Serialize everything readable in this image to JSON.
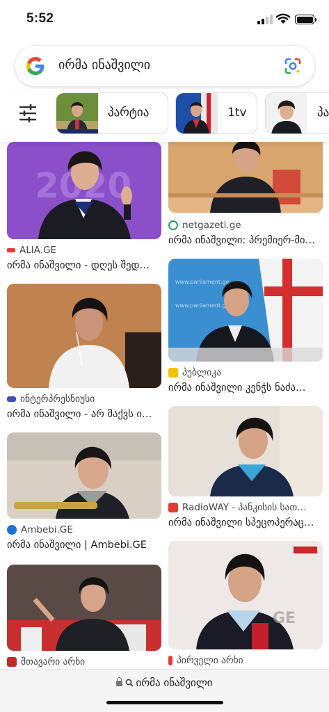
{
  "status_bar": {
    "time": "5:52"
  },
  "search": {
    "query": "ირმა ინაშვილი"
  },
  "chips": [
    {
      "label": "პარტია"
    },
    {
      "label": "1tv"
    },
    {
      "label": "პა"
    }
  ],
  "results_left": [
    {
      "source": "ALIA.GE",
      "title": "ირმა ინაშვილი - დღეს შედ…",
      "favicon_color": "#e53935"
    },
    {
      "source": "ინტერპრესნიუსი",
      "title": "ირმა ინაშვილი - არ მაქვს ი…",
      "favicon_color": "#3f51b5"
    },
    {
      "source": "Ambebi.GE",
      "title": "ირმა ინაშვილი | Ambebi.GE",
      "favicon_color": "#1e6fd9"
    },
    {
      "source": "მთავარი არხი",
      "title": "",
      "favicon_color": "#c62828"
    }
  ],
  "results_right": [
    {
      "source": "",
      "title": "",
      "favicon_color": ""
    },
    {
      "source": "netgazeti.ge",
      "title": "ირმა ინაშვილი: პრემიერ-მი…",
      "favicon_color": "#2e9e5b"
    },
    {
      "source": "პუბლიკა",
      "title": "ირმა ინაშვილი კენჭს ნაძა…",
      "favicon_color": "#f2c200"
    },
    {
      "source": "RadioWAY - პანკისის სათ…",
      "title": "ირმა ინაშვილი სპეცოპერაც…",
      "favicon_color": "#e53935"
    },
    {
      "source": "პირველი არხი",
      "title": "",
      "favicon_color": "#e53935"
    }
  ],
  "bottom_bar": {
    "url": "ირმა ინაშვილი"
  }
}
